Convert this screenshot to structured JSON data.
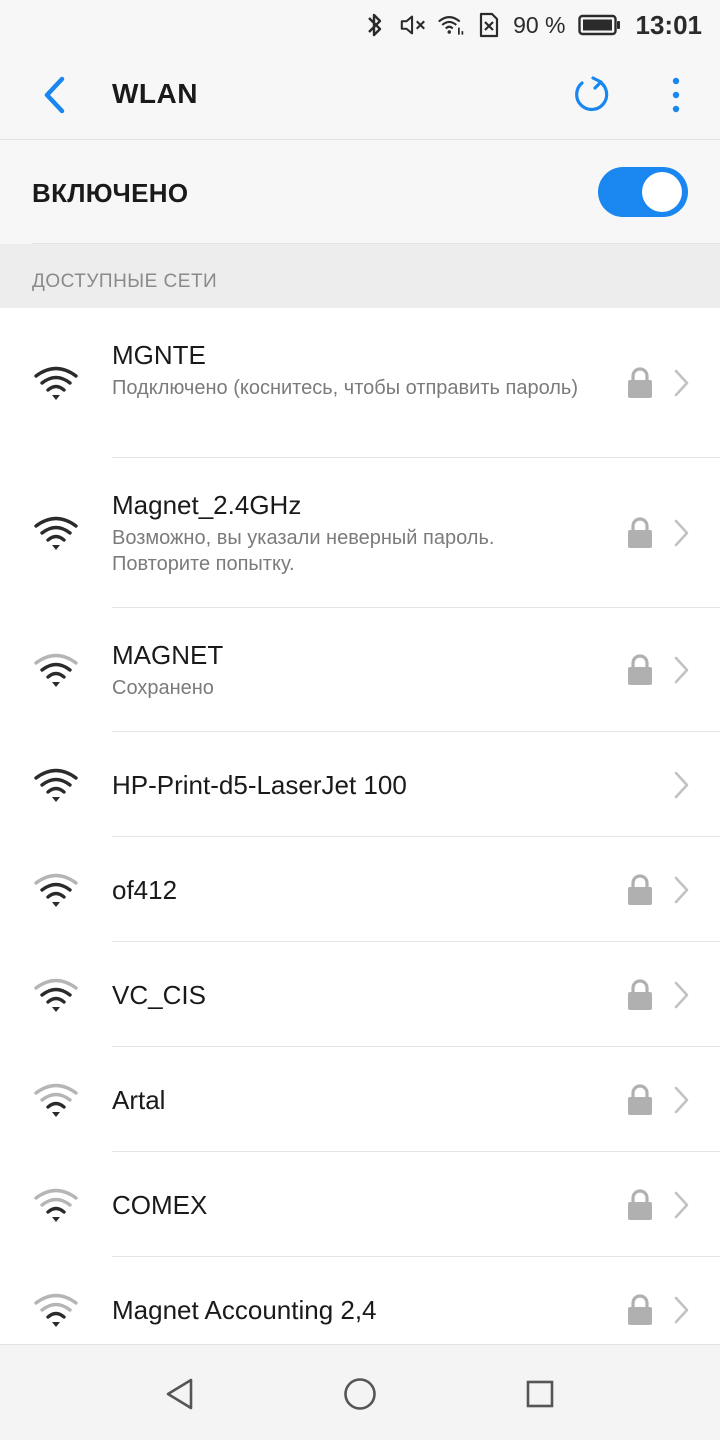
{
  "status_bar": {
    "battery_percent": "90 %",
    "time": "13:01",
    "icons": [
      "bluetooth-icon",
      "mute-icon",
      "wifi-status-icon",
      "no-sim-icon",
      "battery-icon"
    ]
  },
  "app_bar": {
    "title": "WLAN",
    "icons": [
      "back-arrow-icon",
      "refresh-icon",
      "more-vert-icon"
    ]
  },
  "wlan_toggle": {
    "label": "ВКЛЮЧЕНО",
    "on": true
  },
  "available_networks": {
    "header": "ДОСТУПНЫЕ СЕТИ",
    "items": [
      {
        "name": "MGNTE",
        "status": "Подключено (коснитесь, чтобы отправить пароль)",
        "secured": true,
        "signal": "strong"
      },
      {
        "name": "Magnet_2.4GHz",
        "status": "Возможно, вы указали неверный пароль. Повторите попытку.",
        "secured": true,
        "signal": "strong"
      },
      {
        "name": "MAGNET",
        "status": "Сохранено",
        "secured": true,
        "signal": "medium"
      },
      {
        "name": "HP-Print-d5-LaserJet 100",
        "status": "",
        "secured": false,
        "signal": "strong"
      },
      {
        "name": "of412",
        "status": "",
        "secured": true,
        "signal": "medium"
      },
      {
        "name": "VC_CIS",
        "status": "",
        "secured": true,
        "signal": "medium"
      },
      {
        "name": "Artal",
        "status": "",
        "secured": true,
        "signal": "weak"
      },
      {
        "name": "COMEX",
        "status": "",
        "secured": true,
        "signal": "weak"
      },
      {
        "name": "Magnet Accounting 2,4",
        "status": "",
        "secured": true,
        "signal": "weak"
      }
    ]
  },
  "nav_bar": {
    "icons": [
      "nav-back-icon",
      "nav-home-icon",
      "nav-recents-icon"
    ]
  },
  "colors": {
    "accent": "#1a86ef",
    "text_primary": "#1a1a1a",
    "text_secondary": "#7b7b7b",
    "icon_grey": "#b0b0b0"
  }
}
